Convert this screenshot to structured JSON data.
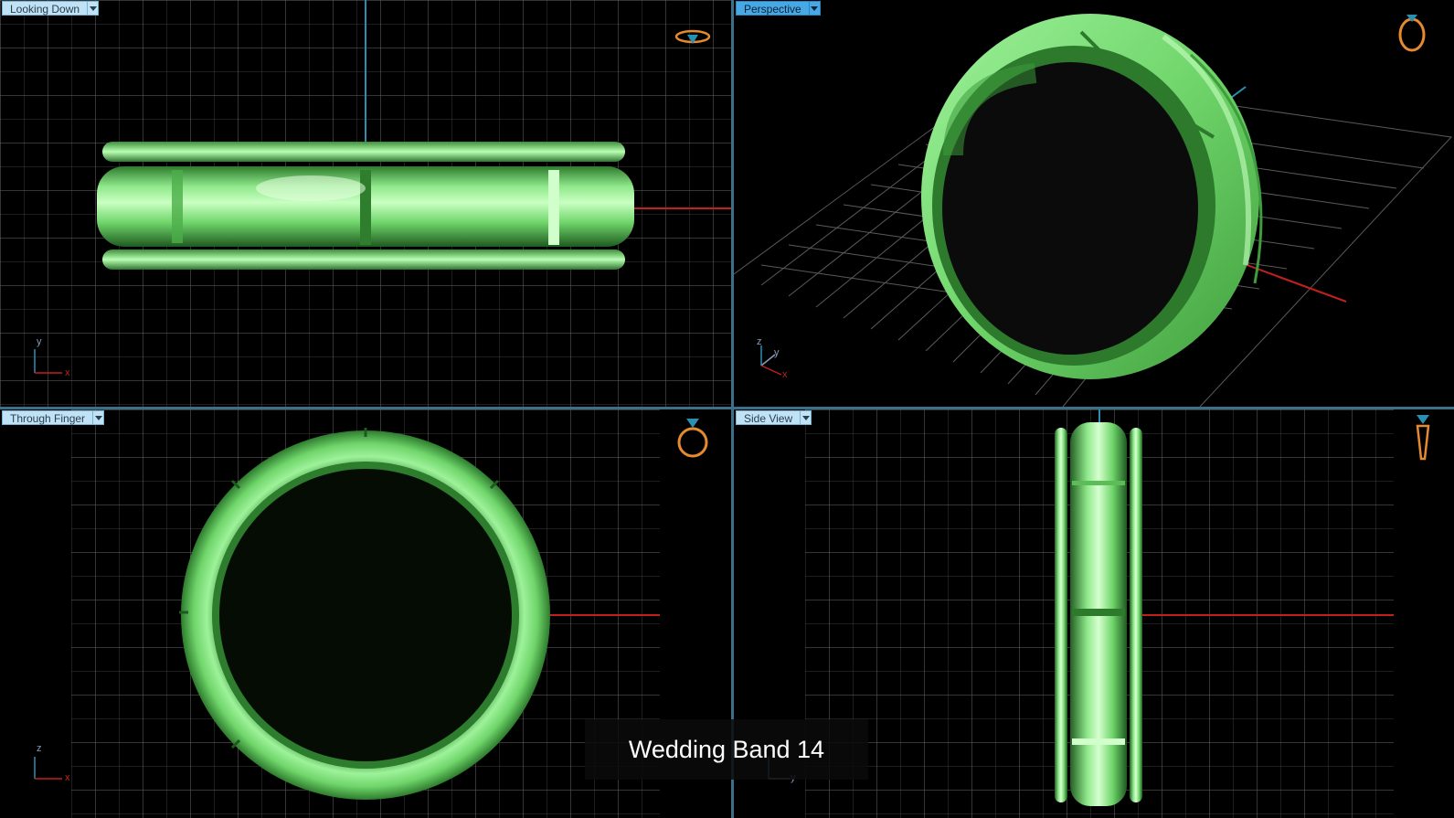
{
  "viewports": {
    "top_left": {
      "label": "Looking Down",
      "view_icon": "ring-top-view-icon"
    },
    "top_right": {
      "label": "Perspective",
      "active": true,
      "view_icon": "ring-perspective-view-icon"
    },
    "bottom_left": {
      "label": "Through Finger",
      "view_icon": "ring-front-view-icon"
    },
    "bottom_right": {
      "label": "Side View",
      "view_icon": "ring-side-view-icon"
    }
  },
  "axes": {
    "top_left": [
      "y",
      "x"
    ],
    "top_right": [
      "z",
      "y",
      "x"
    ],
    "bottom_left": [
      "z",
      "x"
    ],
    "bottom_right": [
      "z",
      "y"
    ]
  },
  "caption": "Wedding Band 14",
  "colors": {
    "ring_green": "#6fd56a",
    "grid": "#3a3a3a",
    "axis_x": "#c0201e",
    "axis_vertical": "#2b8fb3",
    "label_bg": "#bfe2f6",
    "label_active_bg": "#47a8e6",
    "icon_orange": "#e58a2e"
  }
}
